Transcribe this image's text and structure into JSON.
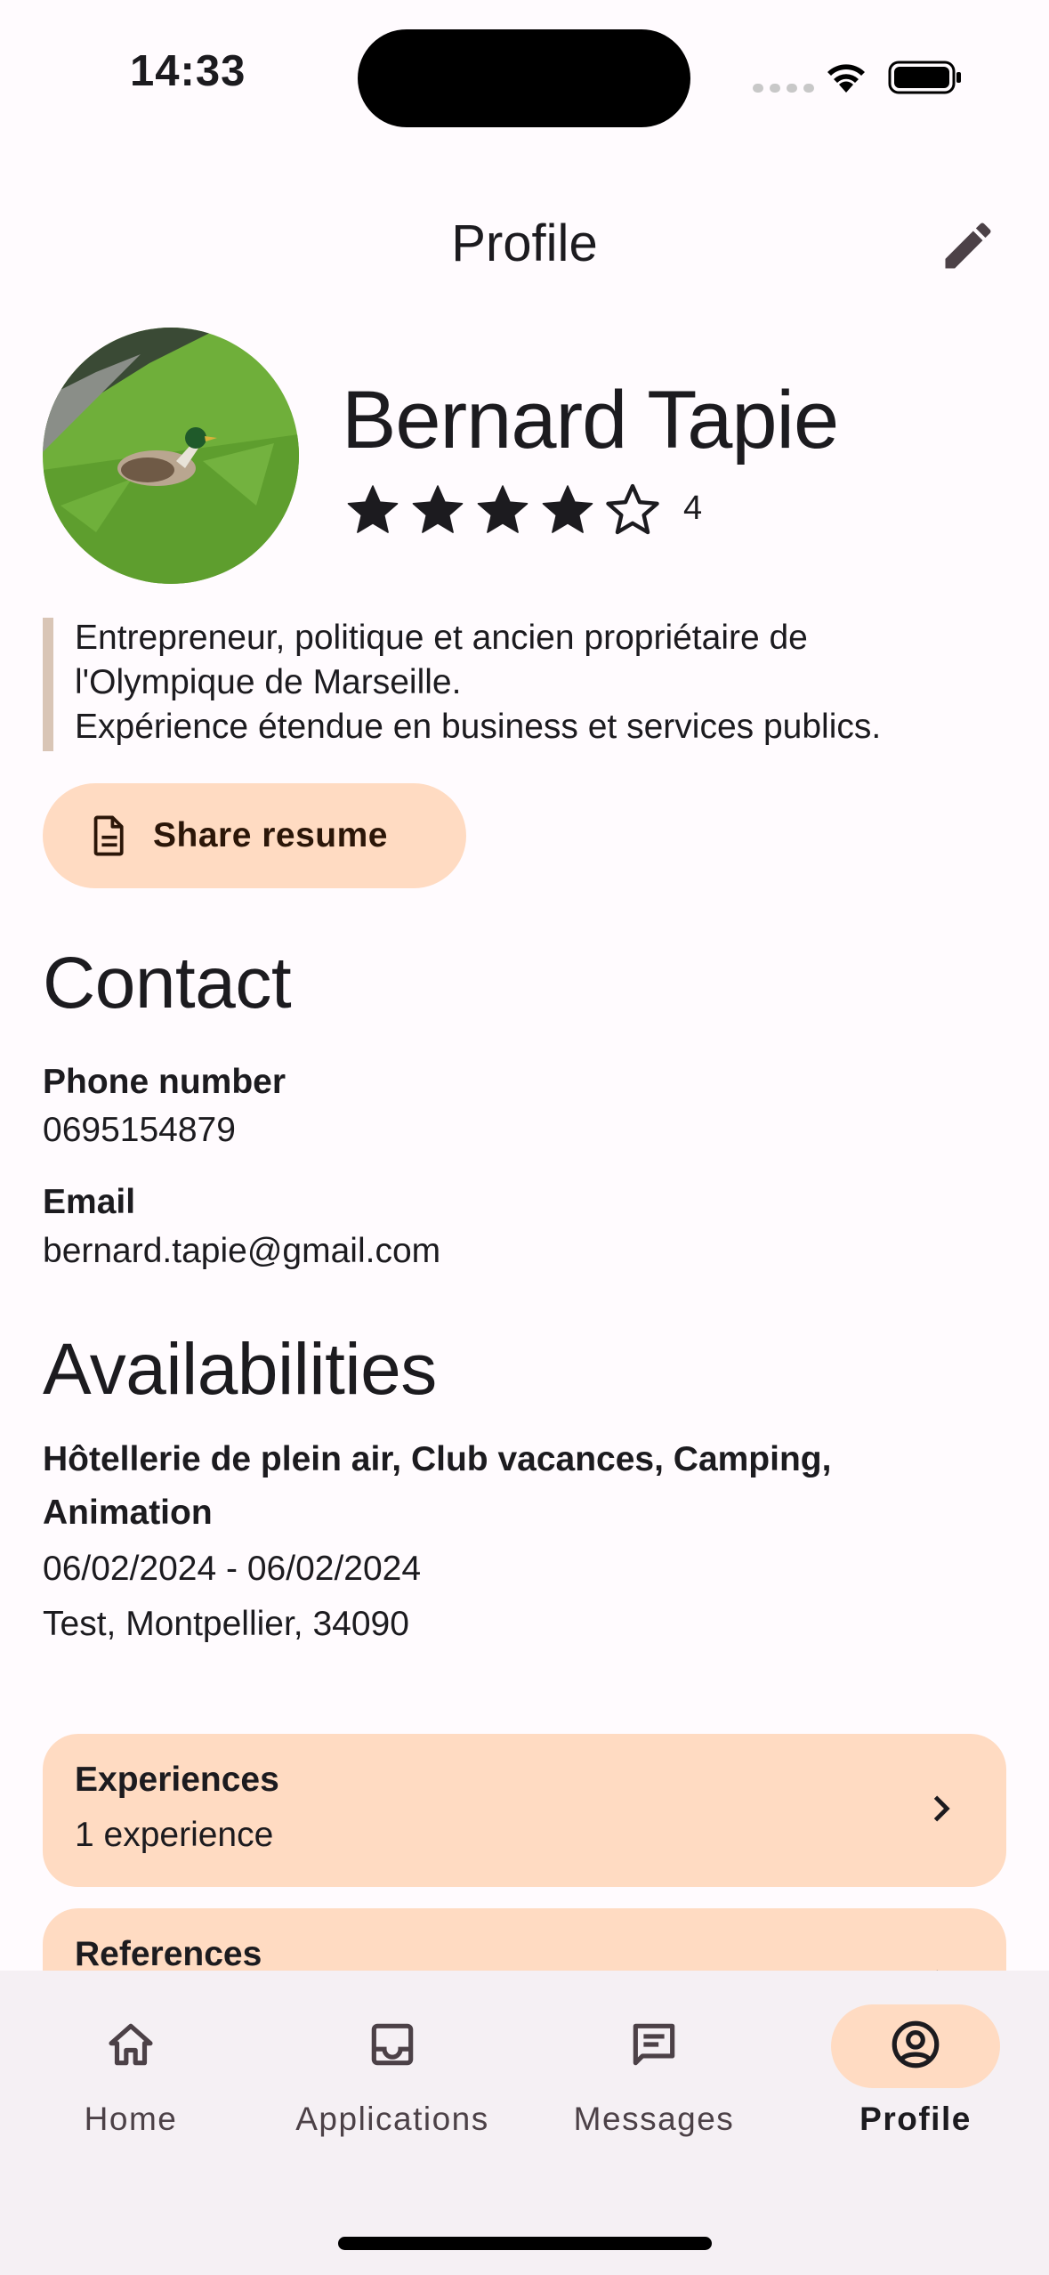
{
  "status": {
    "time": "14:33"
  },
  "topbar": {
    "title": "Profile"
  },
  "profile": {
    "name": "Bernard Tapie",
    "rating": "4",
    "rating_value": 4,
    "rating_max": 5,
    "bio_lines": [
      "Entrepreneur, politique et ancien propriétaire de",
      "l'Olympique de Marseille.",
      "Expérience étendue en business et services publics."
    ],
    "share_label": "Share resume"
  },
  "contact": {
    "heading": "Contact",
    "phone_label": "Phone number",
    "phone": "0695154879",
    "email_label": "Email",
    "email": "bernard.tapie@gmail.com"
  },
  "availabilities": {
    "heading": "Availabilities",
    "categories_line1": "Hôtellerie de plein air, Club vacances, Camping,",
    "categories_line2": "Animation",
    "dates": "06/02/2024 - 06/02/2024",
    "location": "Test, Montpellier, 34090"
  },
  "cards": {
    "experiences": {
      "title": "Experiences",
      "subtitle": "1 experience"
    },
    "references": {
      "title": "References"
    }
  },
  "nav": {
    "items": [
      {
        "label": "Home",
        "icon": "home-icon"
      },
      {
        "label": "Applications",
        "icon": "inbox-icon"
      },
      {
        "label": "Messages",
        "icon": "message-icon"
      },
      {
        "label": "Profile",
        "icon": "account-circle-icon"
      }
    ],
    "active": "Profile"
  },
  "colors": {
    "accent_container": "#FFDBC2",
    "background": "#FFFBFE",
    "nav_background": "#F5F0F4",
    "quote_bar": "#D9C5B6"
  }
}
